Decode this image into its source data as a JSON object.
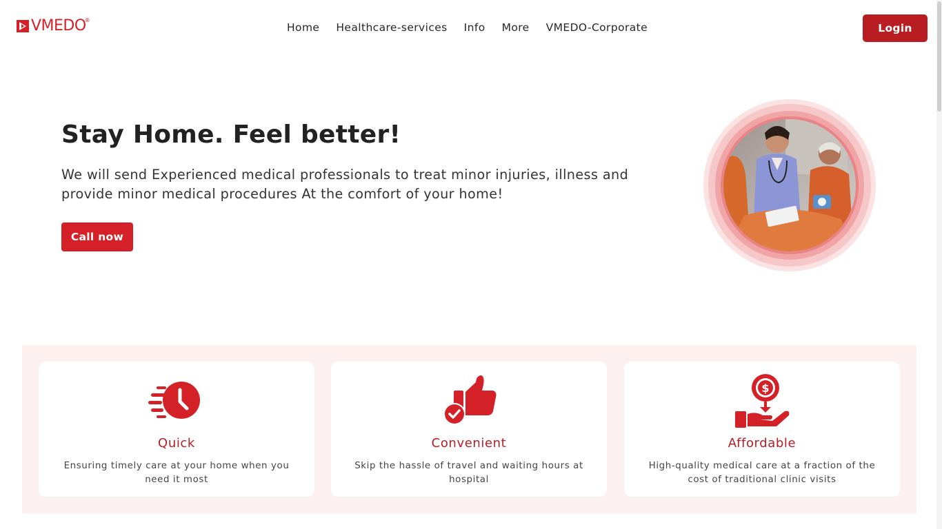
{
  "brand": {
    "name": "VMEDO",
    "reg_mark": "®",
    "color": "#d42127"
  },
  "nav": {
    "items": [
      {
        "label": "Home"
      },
      {
        "label": "Healthcare-services"
      },
      {
        "label": "Info"
      },
      {
        "label": "More"
      },
      {
        "label": "VMEDO-Corporate"
      }
    ]
  },
  "header": {
    "login_label": "Login"
  },
  "hero": {
    "title": "Stay Home. Feel better!",
    "text": "We will send Experienced medical professionals to treat minor injuries, illness and provide minor medical procedures At the comfort of your home!",
    "cta_label": "Call now",
    "image": "nurse-with-elderly-patient-photo"
  },
  "features": [
    {
      "title": "Quick",
      "description": "Ensuring timely care at your home when you need it most",
      "icon": "fast-clock-icon"
    },
    {
      "title": "Convenient",
      "description": "Skip the hassle of travel and waiting hours at hospital",
      "icon": "thumbs-up-check-icon"
    },
    {
      "title": "Affordable",
      "description": "High-quality medical care at a fraction of the cost of traditional clinic visits",
      "icon": "hand-dollar-icon"
    }
  ],
  "colors": {
    "accent": "#d42127",
    "accent_dark": "#b81d22",
    "feature_bg": "#fdf0f0"
  }
}
